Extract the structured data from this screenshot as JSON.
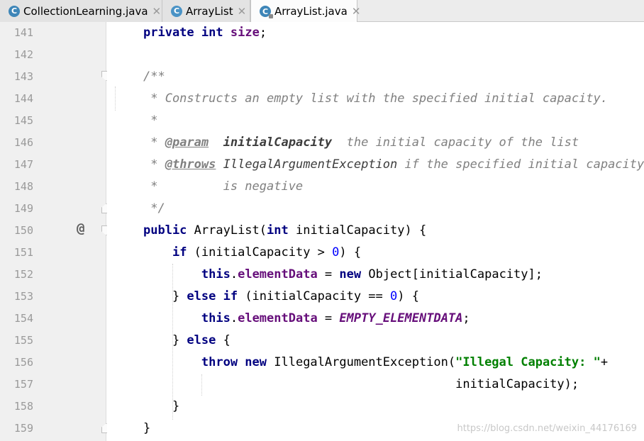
{
  "tabs": [
    {
      "label": "CollectionLearning.java",
      "icon": "class-icon",
      "active": false
    },
    {
      "label": "ArrayList",
      "icon": "class-icon",
      "active": false
    },
    {
      "label": "ArrayList.java",
      "icon": "class-icon",
      "active": true
    }
  ],
  "icons": {
    "class_glyph": "C",
    "close_glyph": "✕",
    "override_marker": "@"
  },
  "editor": {
    "line_numbers": [
      "141",
      "142",
      "143",
      "144",
      "145",
      "146",
      "147",
      "148",
      "149",
      "150",
      "151",
      "152",
      "153",
      "154",
      "155",
      "156",
      "157",
      "158",
      "159"
    ],
    "lines": [
      [
        [
          "kw",
          "private"
        ],
        [
          "t",
          " "
        ],
        [
          "kw",
          "int"
        ],
        [
          "t",
          " "
        ],
        [
          "fld",
          "size"
        ],
        [
          "t",
          ";"
        ]
      ],
      [],
      [
        [
          "doc",
          "/**"
        ]
      ],
      [
        [
          "doc",
          " * Constructs an empty list with the specified initial capacity."
        ]
      ],
      [
        [
          "doc",
          " *"
        ]
      ],
      [
        [
          "doc",
          " * "
        ],
        [
          "dtag",
          "@param"
        ],
        [
          "doc",
          "  "
        ],
        [
          "dparam",
          "initialCapacity"
        ],
        [
          "doc",
          "  the initial capacity of the list"
        ]
      ],
      [
        [
          "doc",
          " * "
        ],
        [
          "dtag",
          "@throws"
        ],
        [
          "doc",
          " "
        ],
        [
          "dlink",
          "IllegalArgumentException"
        ],
        [
          "doc",
          " if the specified initial capacity"
        ]
      ],
      [
        [
          "doc",
          " *         is negative"
        ]
      ],
      [
        [
          "doc",
          " */"
        ]
      ],
      [
        [
          "kw",
          "public"
        ],
        [
          "t",
          " ArrayList("
        ],
        [
          "kw",
          "int"
        ],
        [
          "t",
          " initialCapacity) {"
        ]
      ],
      [
        [
          "t",
          "    "
        ],
        [
          "kw",
          "if"
        ],
        [
          "t",
          " (initialCapacity > "
        ],
        [
          "num",
          "0"
        ],
        [
          "t",
          ") {"
        ]
      ],
      [
        [
          "t",
          "        "
        ],
        [
          "kw",
          "this"
        ],
        [
          "t",
          "."
        ],
        [
          "fld",
          "elementData"
        ],
        [
          "t",
          " = "
        ],
        [
          "kw",
          "new"
        ],
        [
          "t",
          " Object[initialCapacity];"
        ]
      ],
      [
        [
          "t",
          "    } "
        ],
        [
          "kw",
          "else if"
        ],
        [
          "t",
          " (initialCapacity == "
        ],
        [
          "num",
          "0"
        ],
        [
          "t",
          ") {"
        ]
      ],
      [
        [
          "t",
          "        "
        ],
        [
          "kw",
          "this"
        ],
        [
          "t",
          "."
        ],
        [
          "fld",
          "elementData"
        ],
        [
          "t",
          " = "
        ],
        [
          "sfld",
          "EMPTY_ELEMENTDATA"
        ],
        [
          "t",
          ";"
        ]
      ],
      [
        [
          "t",
          "    } "
        ],
        [
          "kw",
          "else"
        ],
        [
          "t",
          " {"
        ]
      ],
      [
        [
          "t",
          "        "
        ],
        [
          "kw",
          "throw new"
        ],
        [
          "t",
          " IllegalArgumentException("
        ],
        [
          "str",
          "\"Illegal Capacity: \""
        ],
        [
          "t",
          "+"
        ]
      ],
      [
        [
          "t",
          "                                           initialCapacity);"
        ]
      ],
      [
        [
          "t",
          "    }"
        ]
      ],
      [
        [
          "t",
          "}"
        ]
      ]
    ]
  },
  "watermark": "https://blog.csdn.net/weixin_44176169",
  "colors": {
    "keyword": "#000080",
    "field": "#660e7a",
    "string": "#008000",
    "number": "#0000ff",
    "comment": "#808080"
  }
}
